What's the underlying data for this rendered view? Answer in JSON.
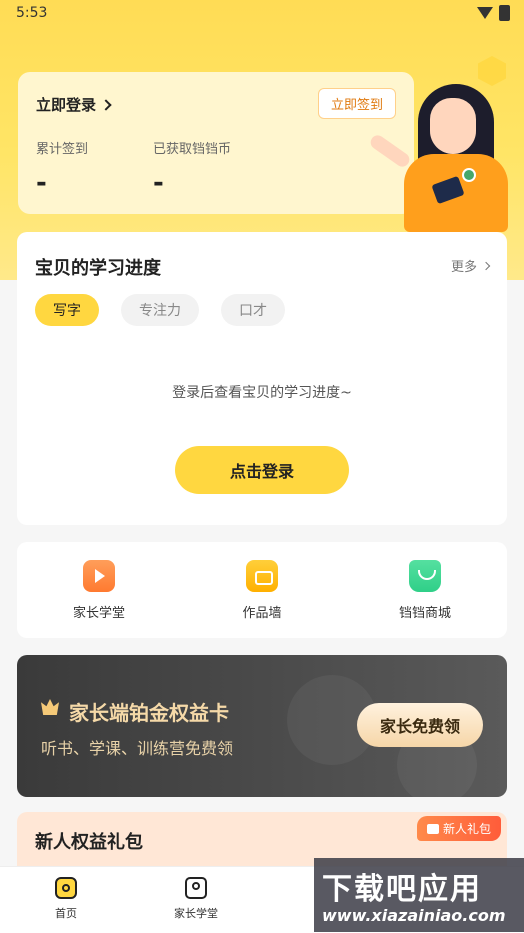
{
  "status_bar": {
    "time": "5:53"
  },
  "login_card": {
    "login_link": "立即登录",
    "checkin_button": "立即签到",
    "stat_checkin_label": "累计签到",
    "stat_checkin_value": "-",
    "stat_coins_label": "已获取铛铛币",
    "stat_coins_value": "-"
  },
  "progress": {
    "title": "宝贝的学习进度",
    "more": "更多",
    "tabs": [
      {
        "label": "写字",
        "active": true
      },
      {
        "label": "专注力",
        "active": false
      },
      {
        "label": "口才",
        "active": false
      }
    ],
    "empty_message": "登录后查看宝贝的学习进度~",
    "login_button": "点击登录"
  },
  "shortcuts": [
    {
      "label": "家长学堂",
      "icon": "tv-icon"
    },
    {
      "label": "作品墙",
      "icon": "gallery-icon"
    },
    {
      "label": "铛铛商城",
      "icon": "shopping-bag-icon"
    }
  ],
  "vip": {
    "title": "家长端铂金权益卡",
    "subtitle": "听书、学课、训练营免费领",
    "button": "家长免费领"
  },
  "gift": {
    "title": "新人权益礼包",
    "tag": "新人礼包"
  },
  "tabbar": [
    {
      "label": "首页",
      "icon": "home-icon"
    },
    {
      "label": "家长学堂",
      "icon": "parent-school-icon"
    }
  ],
  "watermark": {
    "main": "下载吧应用",
    "url": "www.xiazainiao.com"
  }
}
